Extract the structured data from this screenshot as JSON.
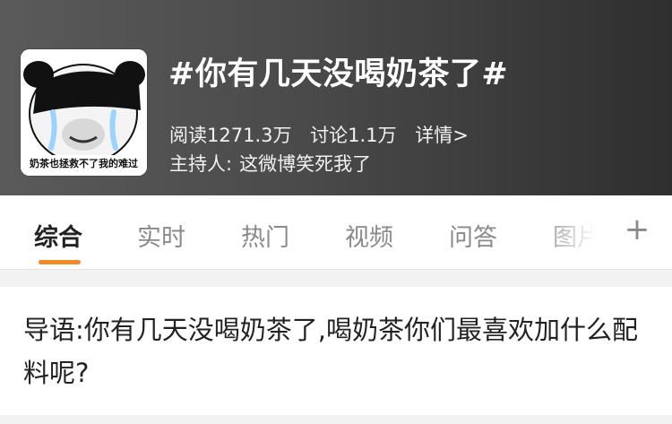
{
  "header": {
    "topic_title": "#你有几天没喝奶茶了#",
    "avatar_caption": "奶茶也拯救不了我的难过",
    "stats": {
      "reads": "阅读1271.3万",
      "discussions": "讨论1.1万",
      "details_link": "详情>"
    },
    "host": {
      "label": "主持人:",
      "name": "这微博笑死我了"
    }
  },
  "tabs": [
    {
      "label": "综合",
      "active": true
    },
    {
      "label": "实时",
      "active": false
    },
    {
      "label": "热门",
      "active": false
    },
    {
      "label": "视频",
      "active": false
    },
    {
      "label": "问答",
      "active": false
    },
    {
      "label": "图片",
      "active": false
    }
  ],
  "add_tab_icon": "plus-icon",
  "intro": {
    "text": "导语:你有几天没喝奶茶了,喝奶茶你们最喜欢加什么配料呢?"
  },
  "colors": {
    "header_dark": "#2f2f2f",
    "header_light": "#5a5a5a",
    "accent_orange": "#f08a24",
    "inactive_tab": "#8a8a8a"
  }
}
